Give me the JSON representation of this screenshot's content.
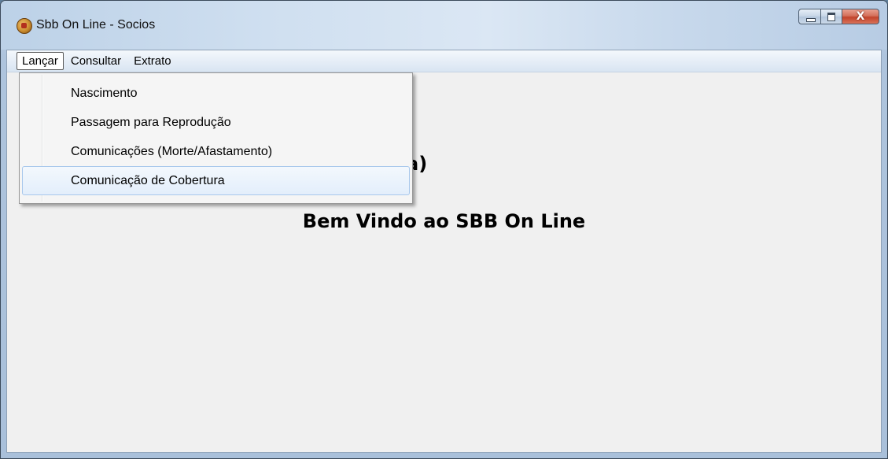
{
  "window": {
    "title": "Sbb On Line - Socios",
    "close_label": "X"
  },
  "menubar": {
    "items": [
      {
        "label": "Lançar"
      },
      {
        "label": "Consultar"
      },
      {
        "label": "Extrato"
      }
    ]
  },
  "dropdown": {
    "items": [
      {
        "label": "Nascimento"
      },
      {
        "label": "Passagem para Reprodução"
      },
      {
        "label": "Comunicações (Morte/Afastamento)"
      },
      {
        "label": "Comunicação de Cobertura"
      }
    ]
  },
  "main": {
    "partial_heading": "a)",
    "welcome": "Bem Vindo ao SBB On Line"
  }
}
